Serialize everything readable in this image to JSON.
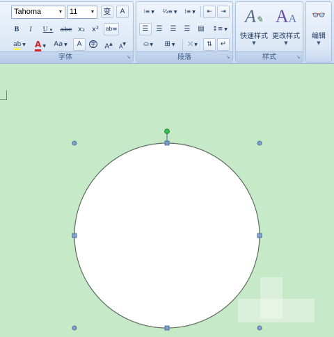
{
  "ribbon": {
    "font_group": {
      "label": "字体",
      "font_name": "Tahoma",
      "font_size": "11",
      "bold": "B",
      "italic": "I",
      "underline": "U",
      "strikethrough": "abe",
      "subscript": "x₂",
      "superscript": "x²",
      "font_color": "A",
      "change_case": "Aa",
      "char_border": "A",
      "enclose_char": "字",
      "grow_font": "A",
      "shrink_font": "A"
    },
    "paragraph_group": {
      "label": "段落"
    },
    "styles_group": {
      "label": "样式",
      "quick_styles": "快速样式",
      "change_styles": "更改样式"
    },
    "editing_group": {
      "label": "编辑"
    }
  },
  "colors": {
    "canvas_bg": "#c6e9c7",
    "handle": "#7b9fcf",
    "rotation_handle": "#2ec04a",
    "font_color_bar": "#d9232e"
  }
}
